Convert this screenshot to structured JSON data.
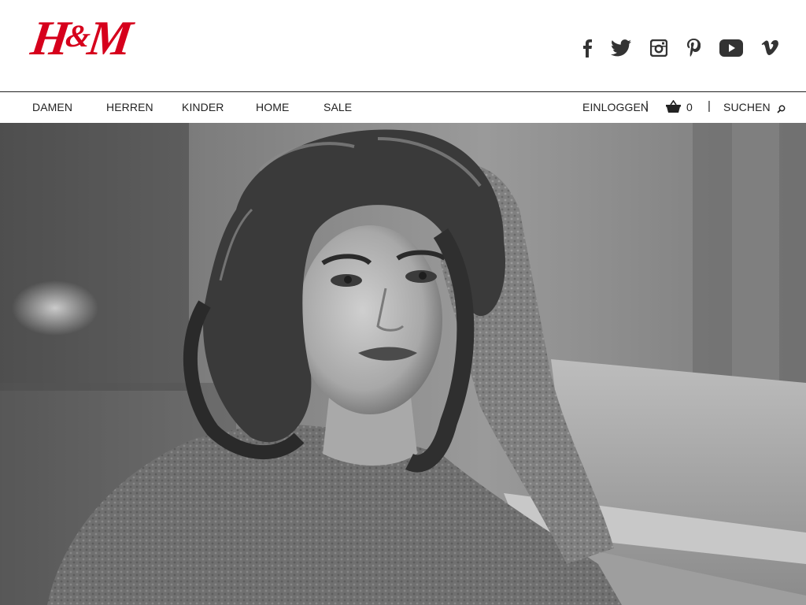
{
  "brand": {
    "logo_text_a": "H",
    "logo_text_amp": "&",
    "logo_text_b": "M",
    "color": "#d6001c"
  },
  "social_icons": [
    "facebook-icon",
    "twitter-icon",
    "instagram-icon",
    "pinterest-icon",
    "youtube-icon",
    "vimeo-icon"
  ],
  "nav": {
    "items": [
      {
        "label": "DAMEN"
      },
      {
        "label": "HERREN"
      },
      {
        "label": "KINDER"
      },
      {
        "label": "HOME"
      },
      {
        "label": "SALE"
      }
    ],
    "login": "EINLOGGEN",
    "separator": "|",
    "cart_count": "0",
    "search": "SUCHEN"
  },
  "hero": {
    "style": "black-and-white photograph"
  }
}
